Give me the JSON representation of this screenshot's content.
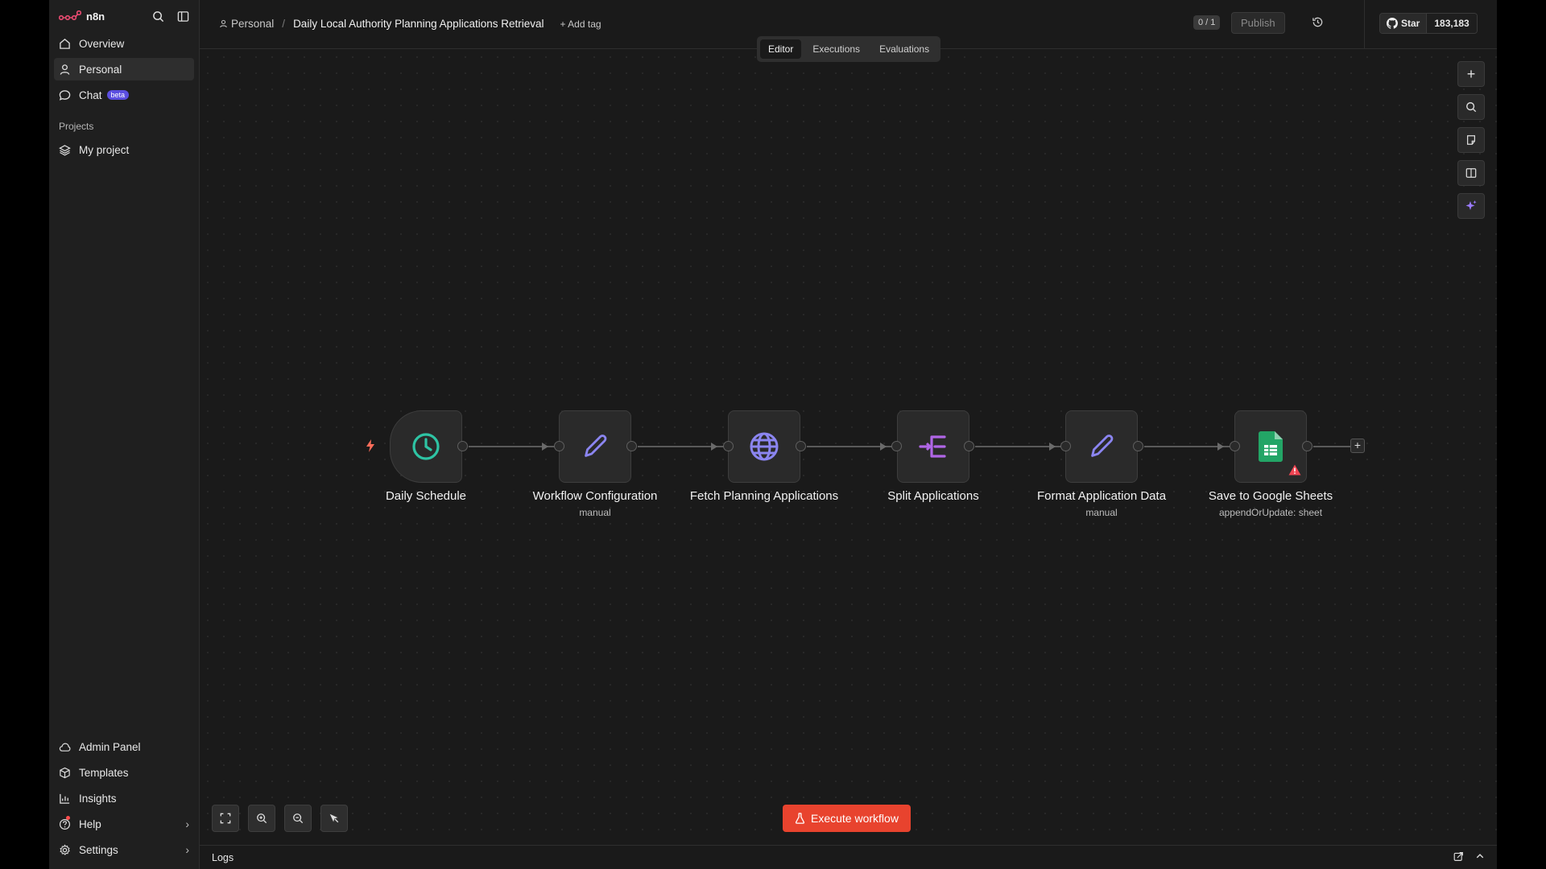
{
  "app": {
    "brand": "n8n"
  },
  "sidebar": {
    "items": [
      {
        "label": "Overview",
        "icon": "home-icon"
      },
      {
        "label": "Personal",
        "icon": "user-icon"
      },
      {
        "label": "Chat",
        "icon": "chat-icon",
        "badge": "beta"
      }
    ],
    "projects_label": "Projects",
    "projects": [
      {
        "label": "My project",
        "icon": "layers-icon"
      }
    ],
    "bottom_items": [
      {
        "label": "Admin Panel",
        "icon": "cloud-icon"
      },
      {
        "label": "Templates",
        "icon": "box-icon"
      },
      {
        "label": "Insights",
        "icon": "chart-icon"
      },
      {
        "label": "Help",
        "icon": "help-icon"
      },
      {
        "label": "Settings",
        "icon": "gear-icon"
      }
    ]
  },
  "header": {
    "project": "Personal",
    "workflow_name": "Daily Local Authority Planning Applications Retrieval",
    "add_tag": "+ Add tag",
    "counter": "0 / 1",
    "publish": "Publish",
    "github_star": "Star",
    "github_count": "183,183"
  },
  "tabs": [
    "Editor",
    "Executions",
    "Evaluations"
  ],
  "active_tab": "Editor",
  "nodes": [
    {
      "name": "Daily Schedule",
      "subtitle": "",
      "icon": "clock-icon",
      "color": "#2ec4a4"
    },
    {
      "name": "Workflow Configuration",
      "subtitle": "manual",
      "icon": "pencil-icon",
      "color": "#8b85f0"
    },
    {
      "name": "Fetch Planning Applications",
      "subtitle": "",
      "icon": "globe-icon",
      "color": "#8b85f0"
    },
    {
      "name": "Split Applications",
      "subtitle": "",
      "icon": "split-icon",
      "color": "#b066e6"
    },
    {
      "name": "Format Application Data",
      "subtitle": "manual",
      "icon": "pencil-icon",
      "color": "#8b85f0"
    },
    {
      "name": "Save to Google Sheets",
      "subtitle": "appendOrUpdate: sheet",
      "icon": "google-sheets-icon",
      "color": "#23a566",
      "warning": true
    }
  ],
  "execute_button": "Execute workflow",
  "logs_label": "Logs",
  "colors": {
    "accent": "#e8432e",
    "trigger_bolt": "#ff6d5a",
    "warning": "#f04452"
  }
}
